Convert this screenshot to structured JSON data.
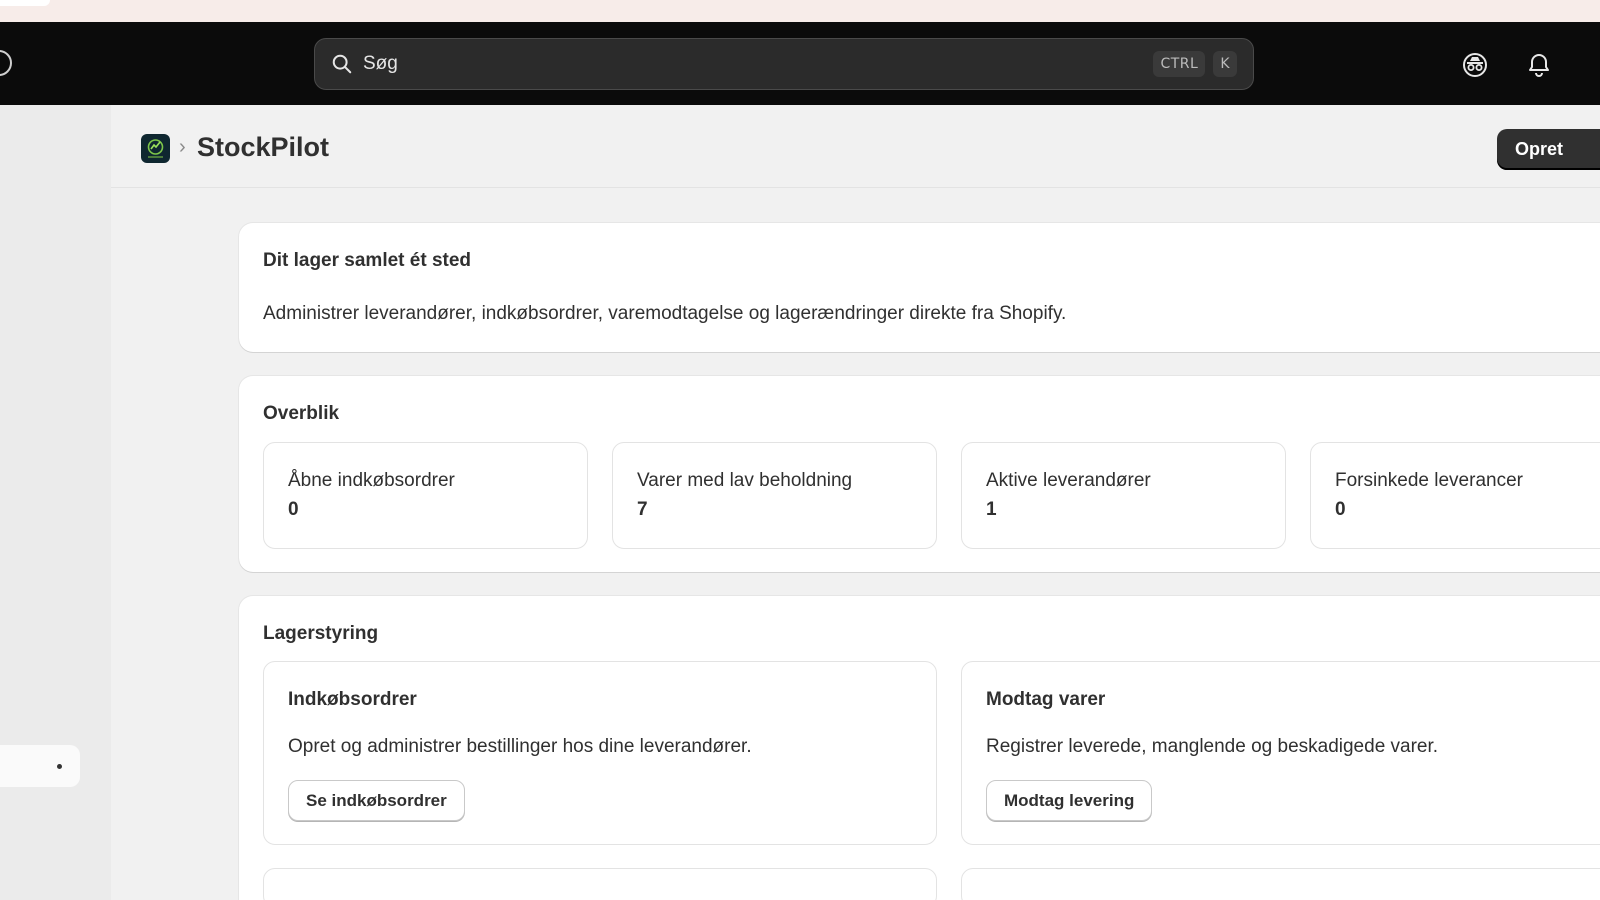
{
  "search": {
    "placeholder": "Søg",
    "shortcut_keys": [
      "CTRL",
      "K"
    ]
  },
  "topbar": {
    "icons": [
      "incognito-icon",
      "bell-icon"
    ]
  },
  "header": {
    "app_name": "StockPilot",
    "separator": "›",
    "create_label": "Opret"
  },
  "intro": {
    "heading": "Dit lager samlet ét sted",
    "text": "Administrer leverandører, indkøbsordrer, varemodtagelse og lagerændringer direkte fra Shopify."
  },
  "overview": {
    "heading": "Overblik",
    "stats": [
      {
        "label": "Åbne indkøbsordrer",
        "value": "0"
      },
      {
        "label": "Varer med lav beholdning",
        "value": "7"
      },
      {
        "label": "Aktive leverandører",
        "value": "1"
      },
      {
        "label": "Forsinkede leverancer",
        "value": "0"
      }
    ]
  },
  "inventory": {
    "heading": "Lagerstyring",
    "features": [
      {
        "title": "Indkøbsordrer",
        "description": "Opret og administrer bestillinger hos dine leverandører.",
        "button": "Se indkøbsordrer"
      },
      {
        "title": "Modtag varer",
        "description": "Registrer leverede, manglende og beskadigede varer.",
        "button": "Modtag levering"
      }
    ]
  }
}
